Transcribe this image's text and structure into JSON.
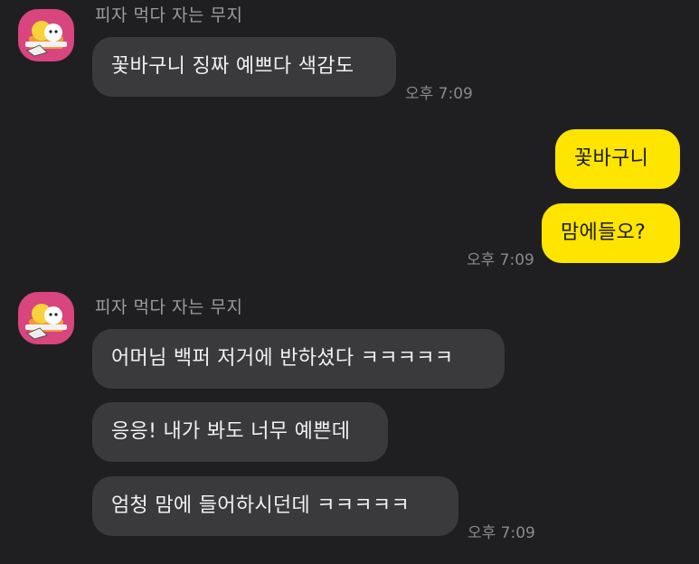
{
  "chat": {
    "groups": [
      {
        "sender": "피자 먹다 자는 무지",
        "messages": [
          "꽃바구니 징짜 예쁘다 색감도"
        ],
        "time": "오후 7:09"
      },
      {
        "messages": [
          "꽃바구니",
          "맘에들오?"
        ],
        "time": "오후 7:09"
      },
      {
        "sender": "피자 먹다 자는 무지",
        "messages": [
          "어머님 백퍼 저거에 반하셨다 ㅋㅋㅋㅋㅋ",
          "응응! 내가 봐도 너무 예쁜데",
          "엄청 맘에 들어하시던데 ㅋㅋㅋㅋㅋ"
        ],
        "time": "오후 7:09"
      }
    ]
  },
  "colors": {
    "background": "#1f1f21",
    "incoming_bubble": "#3a3a3c",
    "outgoing_bubble": "#fee500",
    "avatar": "#d8457f"
  },
  "icons": {
    "avatar": "muzi-pizza-avatar-icon"
  }
}
